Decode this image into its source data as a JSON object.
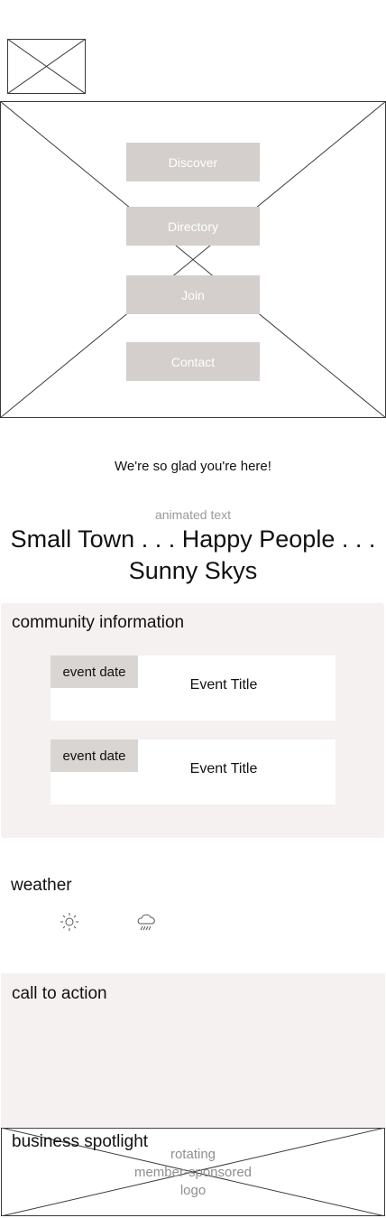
{
  "nav": {
    "items": [
      {
        "label": "Discover"
      },
      {
        "label": "Directory"
      },
      {
        "label": "Join"
      },
      {
        "label": "Contact"
      }
    ]
  },
  "welcome": {
    "text": "We're so glad you're here!"
  },
  "animated": {
    "label": "animated text",
    "text": "Small Town . . . Happy People . . . Sunny Skys"
  },
  "community": {
    "title": "community information",
    "events": [
      {
        "date": "event date",
        "title": "Event Title"
      },
      {
        "date": "event date",
        "title": "Event Title"
      }
    ]
  },
  "weather": {
    "title": "weather",
    "icons": [
      "sun-icon",
      "rain-cloud-icon"
    ]
  },
  "cta": {
    "title": "call to action"
  },
  "spotlight": {
    "title": "business spotlight",
    "caption": "rotating\nmember-sponsored\nlogo"
  },
  "colors": {
    "button_bg": "#d4cfcd",
    "panel_bg": "#f5f1f0",
    "date_bg": "#d9d5d3"
  }
}
